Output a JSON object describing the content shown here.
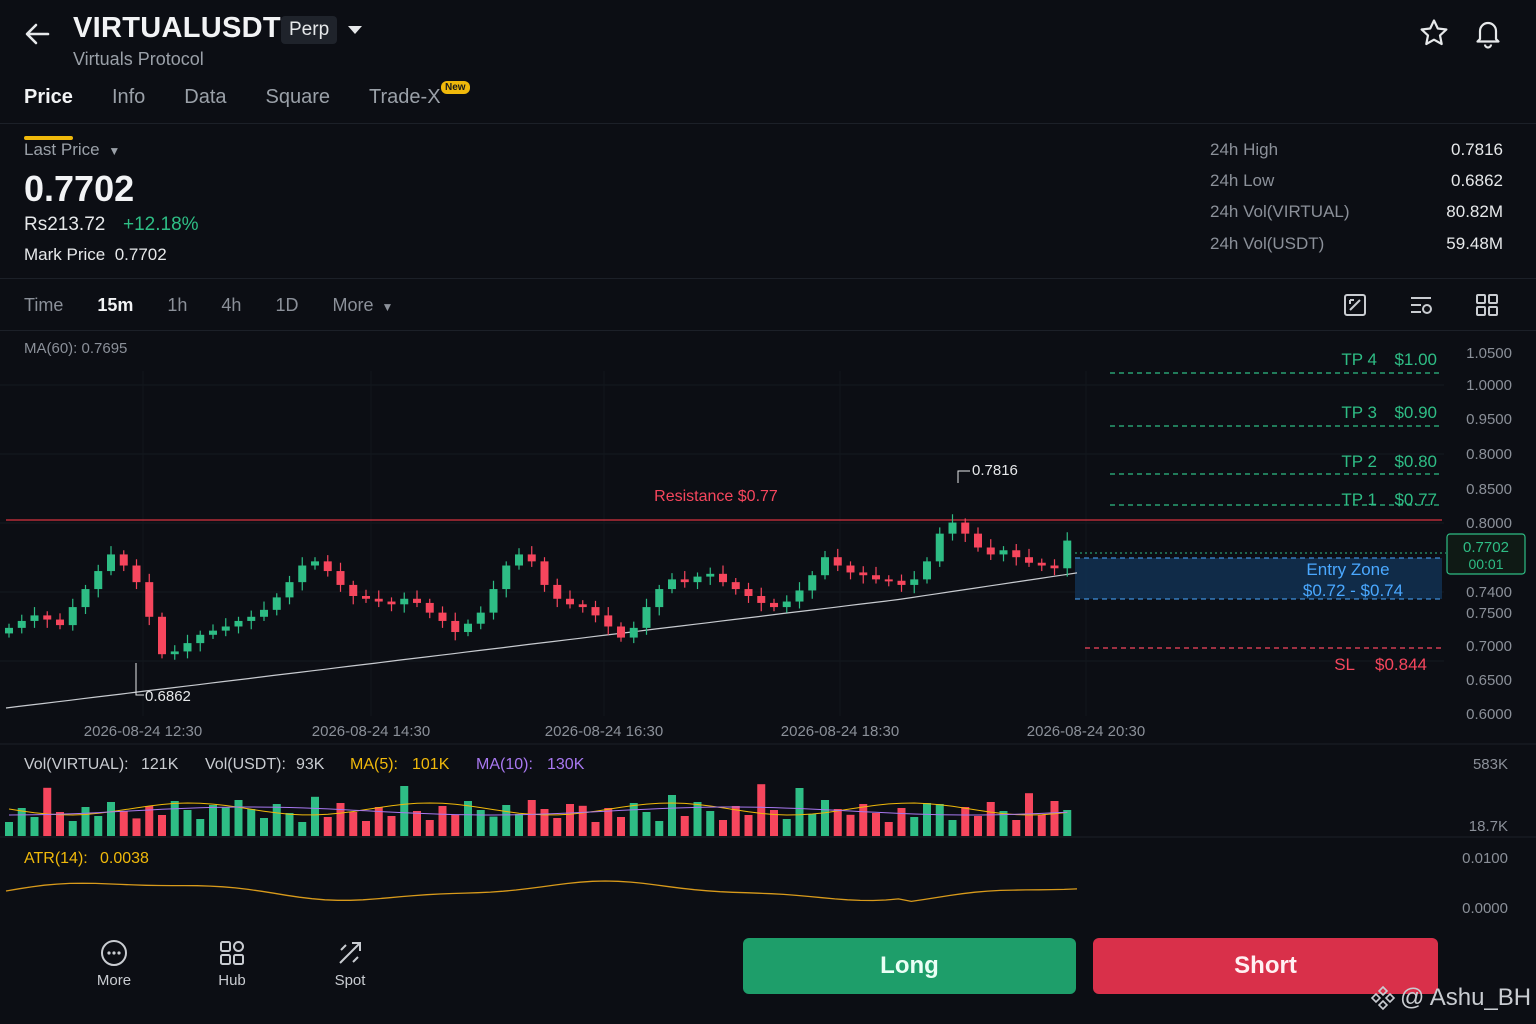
{
  "header": {
    "symbol": "VIRTUALUSDT",
    "contract_type": "Perp",
    "name": "Virtuals Protocol"
  },
  "tabs": [
    {
      "label": "Price",
      "active": true
    },
    {
      "label": "Info"
    },
    {
      "label": "Data"
    },
    {
      "label": "Square"
    },
    {
      "label": "Trade-X",
      "badge": "New"
    }
  ],
  "price": {
    "last_price_label": "Last Price",
    "last_price": "0.7702",
    "fiat": "Rs213.72",
    "change": "+12.18%",
    "mark_price_label": "Mark Price",
    "mark_price": "0.7702"
  },
  "stats": [
    {
      "label": "24h High",
      "value": "0.7816"
    },
    {
      "label": "24h Low",
      "value": "0.6862"
    },
    {
      "label": "24h Vol(VIRTUAL)",
      "value": "80.82M"
    },
    {
      "label": "24h Vol(USDT)",
      "value": "59.48M"
    }
  ],
  "timeframes": [
    {
      "label": "Time"
    },
    {
      "label": "15m",
      "active": true
    },
    {
      "label": "1h"
    },
    {
      "label": "4h"
    },
    {
      "label": "1D"
    },
    {
      "label": "More"
    }
  ],
  "chart_data": {
    "type": "candlestick",
    "indicator_label": "MA(60): 0.7695",
    "y_ticks": [
      "1.0500",
      "1.0000",
      "0.9500",
      "0.8000",
      "0.8500",
      "0.8000",
      "0.7400",
      "0.7500",
      "0.7000",
      "0.6500",
      "0.6000"
    ],
    "x_ticks": [
      "2026-08-24 12:30",
      "2026-08-24 14:30",
      "2026-08-24 16:30",
      "2026-08-24 18:30",
      "2026-08-24 20:30"
    ],
    "high_label": "0.7816",
    "low_label": "0.6862",
    "current_price": "0.7702",
    "countdown": "00:01",
    "levels": {
      "resistance": "Resistance $0.77",
      "tp4": {
        "name": "TP 4",
        "value": "$1.00"
      },
      "tp3": {
        "name": "TP 3",
        "value": "$0.90"
      },
      "tp2": {
        "name": "TP 2",
        "value": "$0.80"
      },
      "tp1": {
        "name": "TP 1",
        "value": "$0.77"
      },
      "entry_title": "Entry Zone",
      "entry_range": "$0.72 - $0.74",
      "sl": {
        "name": "SL",
        "value": "$0.844"
      }
    },
    "candles_close_trend": [
      0.707,
      0.712,
      0.716,
      0.713,
      0.709,
      0.722,
      0.735,
      0.748,
      0.76,
      0.752,
      0.74,
      0.715,
      0.688,
      0.69,
      0.696,
      0.702,
      0.705,
      0.708,
      0.712,
      0.715,
      0.72,
      0.729,
      0.74,
      0.752,
      0.755,
      0.748,
      0.738,
      0.73,
      0.728,
      0.726,
      0.724,
      0.728,
      0.725,
      0.718,
      0.712,
      0.704,
      0.71,
      0.718,
      0.735,
      0.752,
      0.76,
      0.755,
      0.738,
      0.728,
      0.724,
      0.722,
      0.716,
      0.708,
      0.7,
      0.707,
      0.722,
      0.735,
      0.742,
      0.74,
      0.744,
      0.746,
      0.74,
      0.735,
      0.73,
      0.725,
      0.722,
      0.726,
      0.734,
      0.745,
      0.758,
      0.752,
      0.747,
      0.745,
      0.742,
      0.741,
      0.738,
      0.742,
      0.755,
      0.775,
      0.783,
      0.775,
      0.765,
      0.76,
      0.763,
      0.758,
      0.754,
      0.752,
      0.75,
      0.77
    ]
  },
  "volume": {
    "vol_virtual_label": "Vol(VIRTUAL):",
    "vol_virtual": "121K",
    "vol_usdt_label": "Vol(USDT):",
    "vol_usdt": "93K",
    "ma5_label": "MA(5):",
    "ma5": "101K",
    "ma10_label": "MA(10):",
    "ma10": "130K",
    "y_max": "583K",
    "y_min": "18.7K"
  },
  "atr": {
    "label": "ATR(14):",
    "value": "0.0038",
    "y_max": "0.0100",
    "y_min": "0.0000"
  },
  "bottom_nav": [
    {
      "label": "More",
      "icon": "chat-dots-icon"
    },
    {
      "label": "Hub",
      "icon": "grid-icon"
    },
    {
      "label": "Spot",
      "icon": "spot-icon"
    }
  ],
  "actions": {
    "long": "Long",
    "short": "Short"
  },
  "watermark": "@ Ashu_BH",
  "colors": {
    "up": "#2ebd85",
    "down": "#f6465d",
    "accent": "#f0b90b",
    "entry": "#4aa8ff",
    "ma60": "#c8cbd0"
  }
}
